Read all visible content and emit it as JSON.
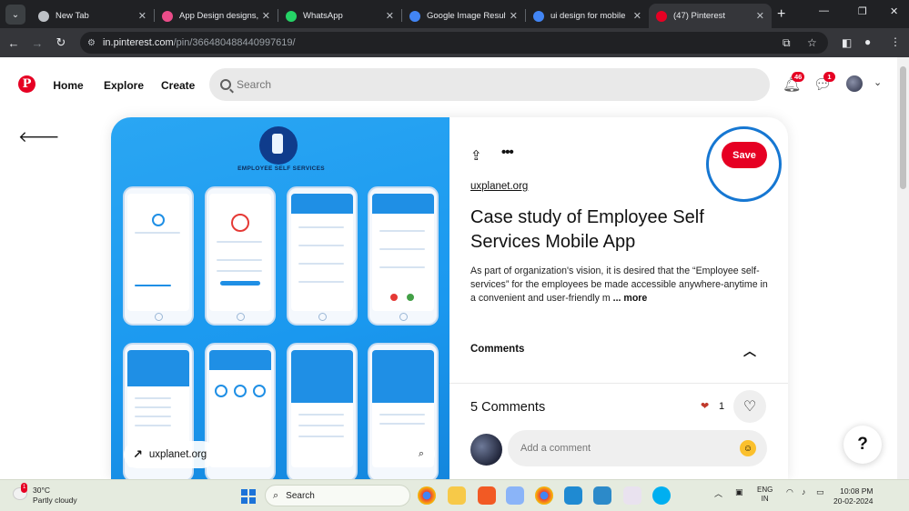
{
  "browser": {
    "tabs": [
      {
        "title": "New Tab",
        "favicon_color": "#bdc1c6"
      },
      {
        "title": "App Design designs,",
        "favicon_color": "#ea4c89"
      },
      {
        "title": "WhatsApp",
        "favicon_color": "#25d366"
      },
      {
        "title": "Google Image Result",
        "favicon_color": "#4285f4"
      },
      {
        "title": "ui design for mobile",
        "favicon_color": "#4285f4"
      },
      {
        "title": "(47) Pinterest",
        "favicon_color": "#e60023"
      }
    ],
    "active_tab_index": 5,
    "url_host": "in.pinterest.com",
    "url_path": "/pin/366480488440997619/"
  },
  "header": {
    "nav": {
      "home": "Home",
      "explore": "Explore",
      "create": "Create"
    },
    "search_placeholder": "Search",
    "notifications_badge": "46",
    "messages_badge": "1"
  },
  "pin": {
    "image_label": "uxplanet.org",
    "image_heading": "EMPLOYEE SELF SERVICES",
    "save_label": "Save",
    "source": "uxplanet.org",
    "title": "Case study of Employee Self Services Mobile App",
    "description": "As part of organization's vision, it is desired that the “Employee self-services” for the employees be made accessible anywhere-anytime in a convenient and user-friendly m ",
    "more_label": "... more",
    "comments_section_label": "Comments",
    "comments_count_label": "5 Comments",
    "reaction_count": "1",
    "comment_placeholder": "Add a comment"
  },
  "help_label": "?",
  "taskbar": {
    "weather_temp": "30°C",
    "weather_desc": "Partly cloudy",
    "weather_badge": "1",
    "search_label": "Search",
    "lang_line1": "ENG",
    "lang_line2": "IN",
    "time": "10:08 PM",
    "date": "20-02-2024"
  },
  "colors": {
    "pinterest_red": "#e60023",
    "save_ring": "#1677d2",
    "pin_image_bg": "#1a98ef"
  }
}
